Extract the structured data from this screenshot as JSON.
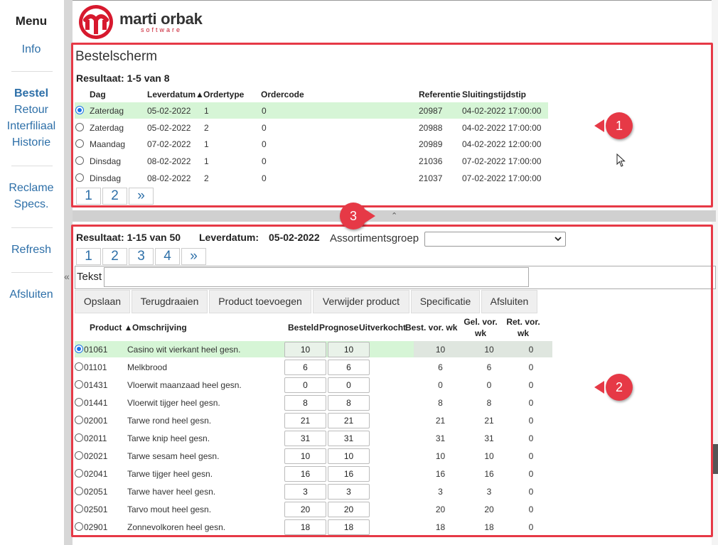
{
  "sidebar": {
    "title": "Menu",
    "items": [
      {
        "label": "Info"
      },
      {
        "label": "Bestel"
      },
      {
        "label": "Retour"
      },
      {
        "label": "Interfiliaal"
      },
      {
        "label": "Historie"
      },
      {
        "label": "Reclame"
      },
      {
        "label": "Specs."
      },
      {
        "label": "Refresh"
      },
      {
        "label": "Afsluiten"
      }
    ],
    "collapse_glyph": "«"
  },
  "logo": {
    "name": "marti orbak",
    "tagline": "software"
  },
  "orders": {
    "title": "Bestelscherm",
    "result": "Resultaat: 1-5 van 8",
    "headers": [
      "Dag",
      "Leverdatum▲",
      "Ordertype",
      "Ordercode",
      "Referentie",
      "Sluitingstijdstip"
    ],
    "rows": [
      {
        "dag": "Zaterdag",
        "leverdatum": "05-02-2022",
        "ordertype": "1",
        "ordercode": "0",
        "referentie": "20987",
        "sluiting": "04-02-2022 17:00:00",
        "selected": true
      },
      {
        "dag": "Zaterdag",
        "leverdatum": "05-02-2022",
        "ordertype": "2",
        "ordercode": "0",
        "referentie": "20988",
        "sluiting": "04-02-2022 17:00:00",
        "selected": false
      },
      {
        "dag": "Maandag",
        "leverdatum": "07-02-2022",
        "ordertype": "1",
        "ordercode": "0",
        "referentie": "20989",
        "sluiting": "04-02-2022 12:00:00",
        "selected": false
      },
      {
        "dag": "Dinsdag",
        "leverdatum": "08-02-2022",
        "ordertype": "1",
        "ordercode": "0",
        "referentie": "21036",
        "sluiting": "07-02-2022 17:00:00",
        "selected": false
      },
      {
        "dag": "Dinsdag",
        "leverdatum": "08-02-2022",
        "ordertype": "2",
        "ordercode": "0",
        "referentie": "21037",
        "sluiting": "07-02-2022 17:00:00",
        "selected": false
      }
    ],
    "pages": [
      "1",
      "2",
      "»"
    ]
  },
  "splitter": {
    "glyph": "⌃"
  },
  "products": {
    "result": "Resultaat: 1-15 van 50",
    "leverdatum_label": "Leverdatum:",
    "leverdatum_value": "05-02-2022",
    "assortiment_label": "Assortimentsgroep",
    "assortiment_value": "",
    "pages": [
      "1",
      "2",
      "3",
      "4",
      "»"
    ],
    "text_label": "Tekst",
    "text_value": "",
    "buttons": [
      "Opslaan",
      "Terugdraaien",
      "Product toevoegen",
      "Verwijder product",
      "Specificatie",
      "Afsluiten"
    ],
    "headers": {
      "product": "Product ▲",
      "omschrijving": "Omschrijving",
      "besteld": "Besteld",
      "prognose": "Prognose",
      "uitverkocht": "Uitverkocht",
      "best_vor": "Best. vor. wk",
      "gel_vor": "Gel. vor. wk",
      "ret_vor": "Ret. vor. wk"
    },
    "rows": [
      {
        "code": "01061",
        "name": "Casino wit vierkant heel gesn.",
        "besteld": "10",
        "prognose": "10",
        "best_vor": "10",
        "gel_vor": "10",
        "ret_vor": "0",
        "selected": true
      },
      {
        "code": "01101",
        "name": "Melkbrood",
        "besteld": "6",
        "prognose": "6",
        "best_vor": "6",
        "gel_vor": "6",
        "ret_vor": "0",
        "selected": false
      },
      {
        "code": "01431",
        "name": "Vloerwit maanzaad heel gesn.",
        "besteld": "0",
        "prognose": "0",
        "best_vor": "0",
        "gel_vor": "0",
        "ret_vor": "0",
        "selected": false
      },
      {
        "code": "01441",
        "name": "Vloerwit tijger heel gesn.",
        "besteld": "8",
        "prognose": "8",
        "best_vor": "8",
        "gel_vor": "8",
        "ret_vor": "0",
        "selected": false
      },
      {
        "code": "02001",
        "name": "Tarwe rond heel gesn.",
        "besteld": "21",
        "prognose": "21",
        "best_vor": "21",
        "gel_vor": "21",
        "ret_vor": "0",
        "selected": false
      },
      {
        "code": "02011",
        "name": "Tarwe knip heel gesn.",
        "besteld": "31",
        "prognose": "31",
        "best_vor": "31",
        "gel_vor": "31",
        "ret_vor": "0",
        "selected": false
      },
      {
        "code": "02021",
        "name": "Tarwe sesam heel gesn.",
        "besteld": "10",
        "prognose": "10",
        "best_vor": "10",
        "gel_vor": "10",
        "ret_vor": "0",
        "selected": false
      },
      {
        "code": "02041",
        "name": "Tarwe tijger heel gesn.",
        "besteld": "16",
        "prognose": "16",
        "best_vor": "16",
        "gel_vor": "16",
        "ret_vor": "0",
        "selected": false
      },
      {
        "code": "02051",
        "name": "Tarwe haver heel gesn.",
        "besteld": "3",
        "prognose": "3",
        "best_vor": "3",
        "gel_vor": "3",
        "ret_vor": "0",
        "selected": false
      },
      {
        "code": "02501",
        "name": "Tarvo mout heel gesn.",
        "besteld": "20",
        "prognose": "20",
        "best_vor": "20",
        "gel_vor": "20",
        "ret_vor": "0",
        "selected": false
      },
      {
        "code": "02901",
        "name": "Zonnevolkoren heel gesn.",
        "besteld": "18",
        "prognose": "18",
        "best_vor": "18",
        "gel_vor": "18",
        "ret_vor": "0",
        "selected": false
      }
    ]
  },
  "callouts": [
    "1",
    "2",
    "3"
  ],
  "colors": {
    "accent_red": "#e63946",
    "link_blue": "#2d6fa8",
    "selected_row": "#d6f5d6"
  }
}
